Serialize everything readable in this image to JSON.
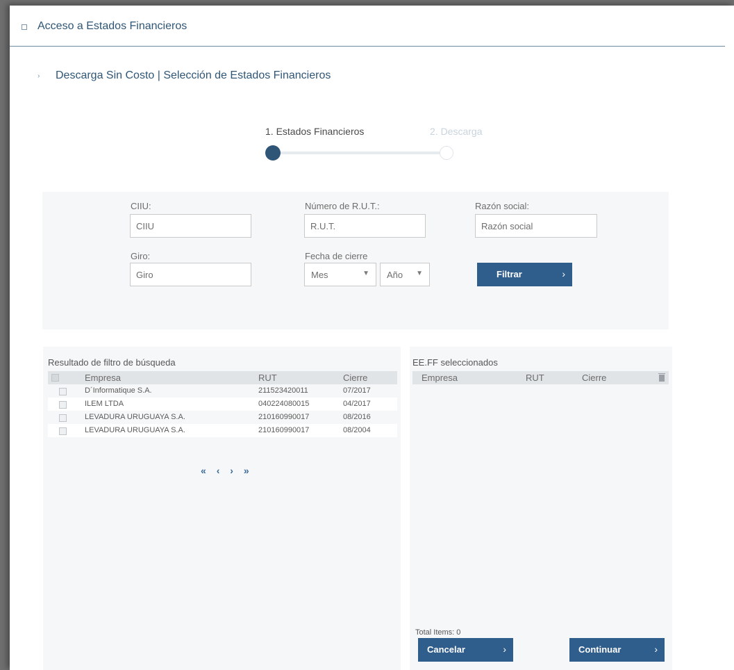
{
  "section": {
    "title": "Acceso a Estados Financieros"
  },
  "subsection": {
    "title": "Descarga Sin Costo | Selección de Estados Financieros"
  },
  "stepper": {
    "steps": [
      "1. Estados Financieros",
      "2. Descarga"
    ],
    "current_step": 1,
    "accent": "#2f5677"
  },
  "filters": {
    "ciiu": {
      "label": "CIIU:",
      "placeholder": "CIIU"
    },
    "rut": {
      "label": "Número de R.U.T.:",
      "placeholder": "R.U.T."
    },
    "razon": {
      "label": "Razón social:",
      "placeholder": "Razón social"
    },
    "giro": {
      "label": "Giro:",
      "placeholder": "Giro"
    },
    "fecha": {
      "label": "Fecha de cierre",
      "mes": "Mes",
      "anio": "Año"
    },
    "filter_button": "Filtrar"
  },
  "results": {
    "title": "Resultado de filtro de búsqueda",
    "columns": [
      "Empresa",
      "RUT",
      "Cierre"
    ],
    "rows": [
      {
        "empresa": "D´Informatique S.A.",
        "rut": "211523420011",
        "cierre": "07/2017"
      },
      {
        "empresa": "ILEM LTDA",
        "rut": "040224080015",
        "cierre": "04/2017"
      },
      {
        "empresa": "LEVADURA URUGUAYA S.A.",
        "rut": "210160990017",
        "cierre": "08/2016"
      },
      {
        "empresa": "LEVADURA URUGUAYA S.A.",
        "rut": "210160990017",
        "cierre": "08/2004"
      }
    ],
    "pager": {
      "first": "«",
      "prev": "‹",
      "next": "›",
      "last": "»"
    }
  },
  "selected": {
    "title": "EE.FF seleccionados",
    "columns": [
      "Empresa",
      "RUT",
      "Cierre"
    ],
    "trash_icon": "trash-icon",
    "total": "Total Items: 0",
    "cancel_button": "Cancelar",
    "continue_button": "Continuar"
  },
  "colors": {
    "button": "#2f5d8c",
    "heading": "#2f5677",
    "panel": "#f6f7f8"
  }
}
